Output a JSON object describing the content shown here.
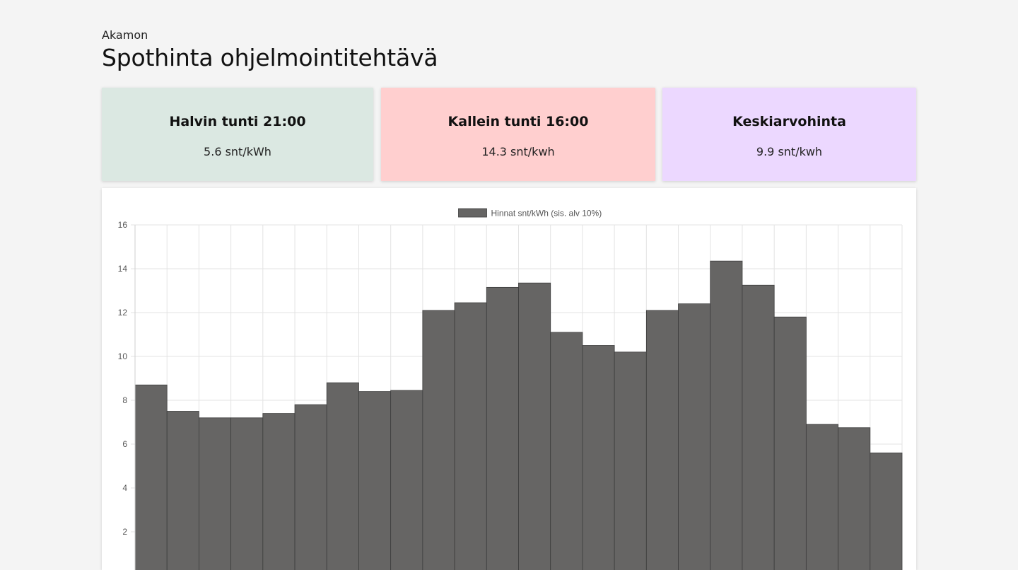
{
  "header": {
    "subtitle": "Akamon",
    "title": "Spothinta ohjelmointitehtävä"
  },
  "cards": [
    {
      "title": "Halvin tunti 21:00",
      "value": "5.6 snt/kWh",
      "color": "#dbe8e2"
    },
    {
      "title": "Kallein tunti 16:00",
      "value": "14.3 snt/kwh",
      "color": "#ffcfcf"
    },
    {
      "title": "Keskiarvohinta",
      "value": "9.9 snt/kwh",
      "color": "#ecd8ff"
    }
  ],
  "chart_data": {
    "type": "bar",
    "series": [
      {
        "name": "Hinnat snt/kWh (sis. alv 10%)",
        "values": [
          8.7,
          7.5,
          7.2,
          7.2,
          7.4,
          7.8,
          8.8,
          8.4,
          8.45,
          12.1,
          12.45,
          13.15,
          13.35,
          11.1,
          10.5,
          10.2,
          12.1,
          12.4,
          14.35,
          13.25,
          11.8,
          6.9,
          6.75,
          5.6
        ]
      }
    ],
    "yticks": [
      "16",
      "14",
      "12",
      "10",
      "8",
      "6",
      "4",
      "2"
    ],
    "ylim": [
      0,
      16
    ],
    "grid": true,
    "legend": "top-center",
    "bar_color": "#666564"
  }
}
